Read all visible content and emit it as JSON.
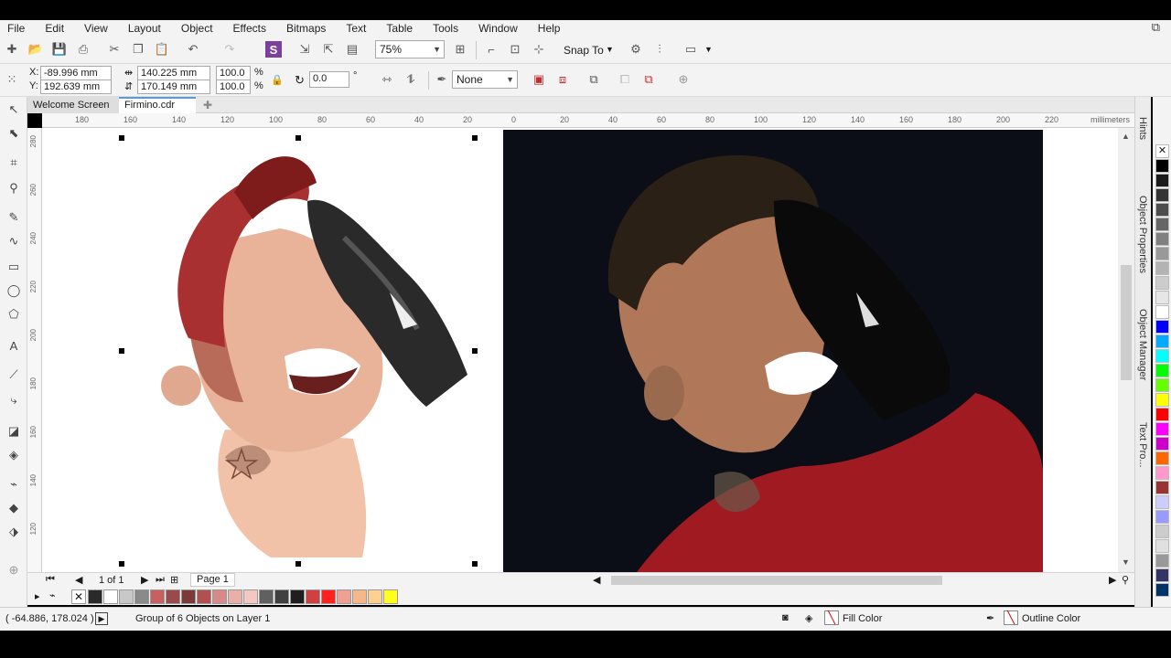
{
  "menu": [
    "File",
    "Edit",
    "View",
    "Layout",
    "Object",
    "Effects",
    "Bitmaps",
    "Text",
    "Table",
    "Tools",
    "Window",
    "Help"
  ],
  "toolbar": {
    "zoom": "75%",
    "snap_to": "Snap To"
  },
  "props": {
    "x": "-89.996 mm",
    "y": "192.639 mm",
    "width": "140.225 mm",
    "height": "170.149 mm",
    "scale_x": "100.0",
    "scale_y": "100.0",
    "percent": "%",
    "angle": "0.0",
    "degree": "°",
    "outline": "None"
  },
  "tabs": {
    "welcome": "Welcome Screen",
    "file": "Firmino.cdr"
  },
  "ruler": {
    "top_ticks": [
      "180",
      "160",
      "140",
      "120",
      "100",
      "80",
      "60",
      "40",
      "20",
      "0",
      "20",
      "40",
      "60",
      "80",
      "100",
      "120",
      "140",
      "160",
      "180",
      "200",
      "220"
    ],
    "left_ticks": [
      "280",
      "260",
      "240",
      "220",
      "200",
      "180",
      "160",
      "140",
      "120"
    ],
    "units": "millimeters"
  },
  "page_nav": {
    "counter": "1 of 1",
    "page": "Page 1"
  },
  "status": {
    "coords": "( -64.886, 178.024 )",
    "selection": "Group of 6 Objects on Layer 1",
    "fill": "Fill Color",
    "outline": "Outline Color"
  },
  "dock": {
    "hints": "Hints",
    "object_properties": "Object Properties",
    "object_manager": "Object Manager",
    "text_properties": "Text Pro..."
  },
  "palette": [
    "#2a2a2a",
    "#ffffff",
    "#c8c8c8",
    "#8a8a8a",
    "#c96060",
    "#9a4a4a",
    "#7a3a3a",
    "#b05050",
    "#d88a8a",
    "#e8b0a8",
    "#f2c8c0",
    "#606060",
    "#404040",
    "#1e1e1e",
    "#d04040",
    "#ff2020",
    "#f0a090",
    "#f4b88a",
    "#ffd090",
    "#ffff20"
  ],
  "right_palette": [
    "#000000",
    "#1a1a1a",
    "#333333",
    "#4d4d4d",
    "#666666",
    "#808080",
    "#999999",
    "#b3b3b3",
    "#cccccc",
    "#e6e6e6",
    "#ffffff",
    "#0000ff",
    "#00aaff",
    "#00ffff",
    "#00ff00",
    "#66ff00",
    "#ffff00",
    "#ff0000",
    "#ff00ff",
    "#cc00cc",
    "#ff6600",
    "#ff99cc",
    "#993333",
    "#ccccff",
    "#9999ff",
    "#cccccc",
    "#e0e0e0",
    "#999999",
    "#333366",
    "#003366"
  ]
}
